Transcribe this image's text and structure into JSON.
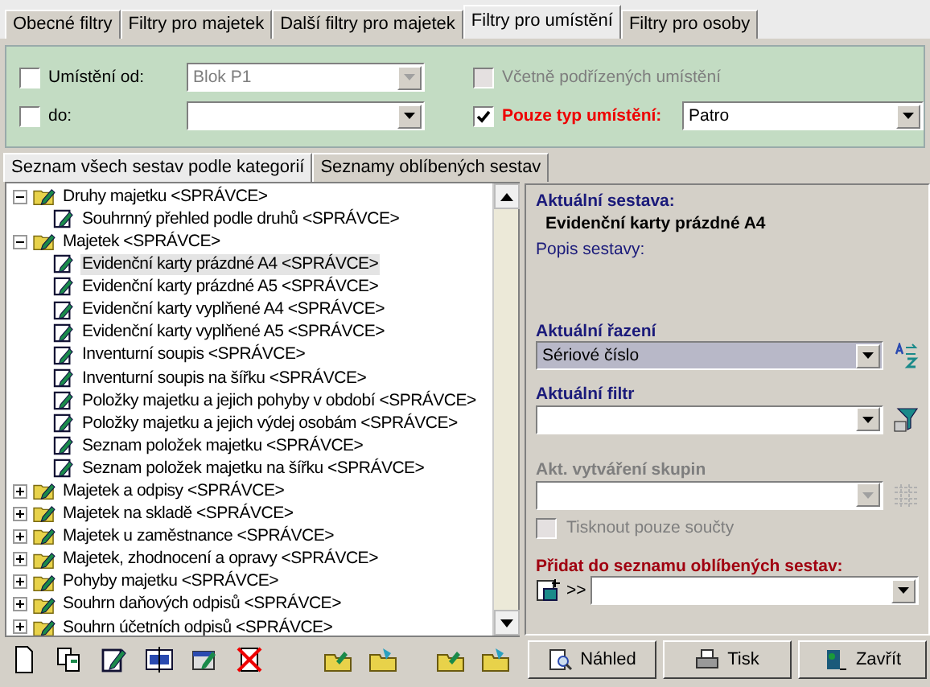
{
  "top_tabs": [
    {
      "label": "Obecné filtry",
      "selected": false
    },
    {
      "label": "Filtry pro majetek",
      "selected": false
    },
    {
      "label": "Další filtry pro majetek",
      "selected": false
    },
    {
      "label": "Filtry pro umístění",
      "selected": true
    },
    {
      "label": "Filtry pro osoby",
      "selected": false
    }
  ],
  "location_filter": {
    "from": {
      "label": "Umístění od:",
      "checked": false,
      "value": "Blok P1",
      "disabled": true
    },
    "to": {
      "label": "do:",
      "checked": false,
      "disabled": false
    },
    "include_children": {
      "label": "Včetně podřízených umístění",
      "checked": false,
      "disabled": true
    },
    "type_only": {
      "label": "Pouze typ umístění:",
      "checked": true,
      "value": "Patro"
    }
  },
  "list_tabs": [
    {
      "label": "Seznam všech sestav podle kategorií",
      "selected": true
    },
    {
      "label": "Seznamy oblíbených sestav",
      "selected": false
    }
  ],
  "tree": [
    {
      "label": "Druhy majetku  <SPRÁVCE>",
      "expanded": true,
      "children": [
        {
          "label": "Souhrnný přehled podle druhů  <SPRÁVCE>",
          "selected": false
        }
      ]
    },
    {
      "label": "Majetek  <SPRÁVCE>",
      "expanded": true,
      "children": [
        {
          "label": "Evidenční karty prázdné A4  <SPRÁVCE>",
          "selected": true
        },
        {
          "label": "Evidenční karty prázdné A5  <SPRÁVCE>",
          "selected": false
        },
        {
          "label": "Evidenční karty vyplňené A4  <SPRÁVCE>",
          "selected": false
        },
        {
          "label": "Evidenční karty vyplňené A5  <SPRÁVCE>",
          "selected": false
        },
        {
          "label": "Inventurní soupis  <SPRÁVCE>",
          "selected": false
        },
        {
          "label": "Inventurní soupis na šířku  <SPRÁVCE>",
          "selected": false
        },
        {
          "label": "Položky majetku a jejich pohyby v období  <SPRÁVCE>",
          "selected": false
        },
        {
          "label": "Položky majetku a jejich výdej osobám  <SPRÁVCE>",
          "selected": false
        },
        {
          "label": "Seznam položek majetku  <SPRÁVCE>",
          "selected": false
        },
        {
          "label": "Seznam položek majetku na šířku  <SPRÁVCE>",
          "selected": false
        }
      ]
    },
    {
      "label": "Majetek a odpisy  <SPRÁVCE>",
      "expanded": false
    },
    {
      "label": "Majetek na skladě  <SPRÁVCE>",
      "expanded": false
    },
    {
      "label": "Majetek u zaměstnance  <SPRÁVCE>",
      "expanded": false
    },
    {
      "label": "Majetek, zhodnocení a opravy  <SPRÁVCE>",
      "expanded": false
    },
    {
      "label": "Pohyby majetku  <SPRÁVCE>",
      "expanded": false
    },
    {
      "label": "Souhrn daňových odpisů  <SPRÁVCE>",
      "expanded": false
    },
    {
      "label": "Souhrn účetních odpisů  <SPRÁVCE>",
      "expanded": false
    }
  ],
  "detail": {
    "current_label": "Aktuální sestava:",
    "current_name": "Evidenční karty prázdné A4",
    "description_label": "Popis sestavy:",
    "sort_label": "Aktuální řazení",
    "sort_value": "Sériové číslo",
    "filter_label": "Aktuální filtr",
    "grouping_label": "Akt. vytváření skupin",
    "grouping_disabled": true,
    "sums_only": {
      "label": "Tisknout pouze součty",
      "checked": false,
      "disabled": true
    },
    "favorites_label": "Přidat do seznamu oblíbených sestav:",
    "favorites_arrow": ">>"
  },
  "buttons": [
    "Náhled",
    "Tisk",
    "Zavřít"
  ]
}
